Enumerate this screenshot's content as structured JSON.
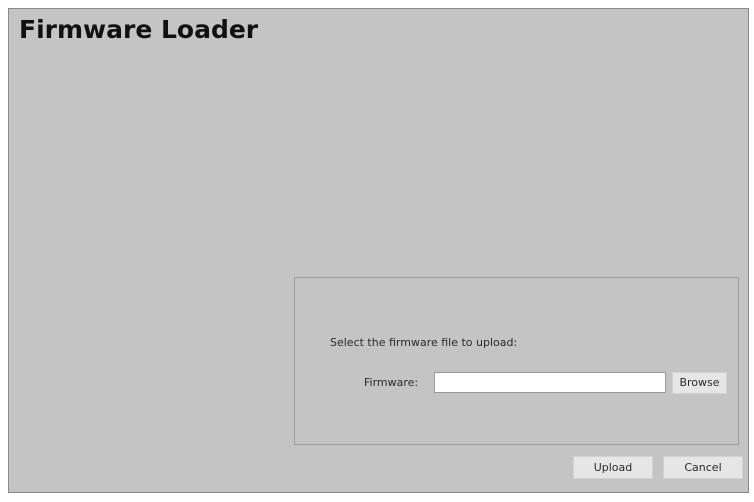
{
  "window": {
    "title": "Firmware Loader"
  },
  "upload_panel": {
    "prompt": "Select the firmware file to upload:",
    "firmware_label": "Firmware:",
    "firmware_value": "",
    "browse_label": "Browse"
  },
  "actions": {
    "upload_label": "Upload",
    "cancel_label": "Cancel"
  },
  "colors": {
    "background": "#c4c4c4",
    "button": "#e6e6e6",
    "input": "#ffffff"
  }
}
